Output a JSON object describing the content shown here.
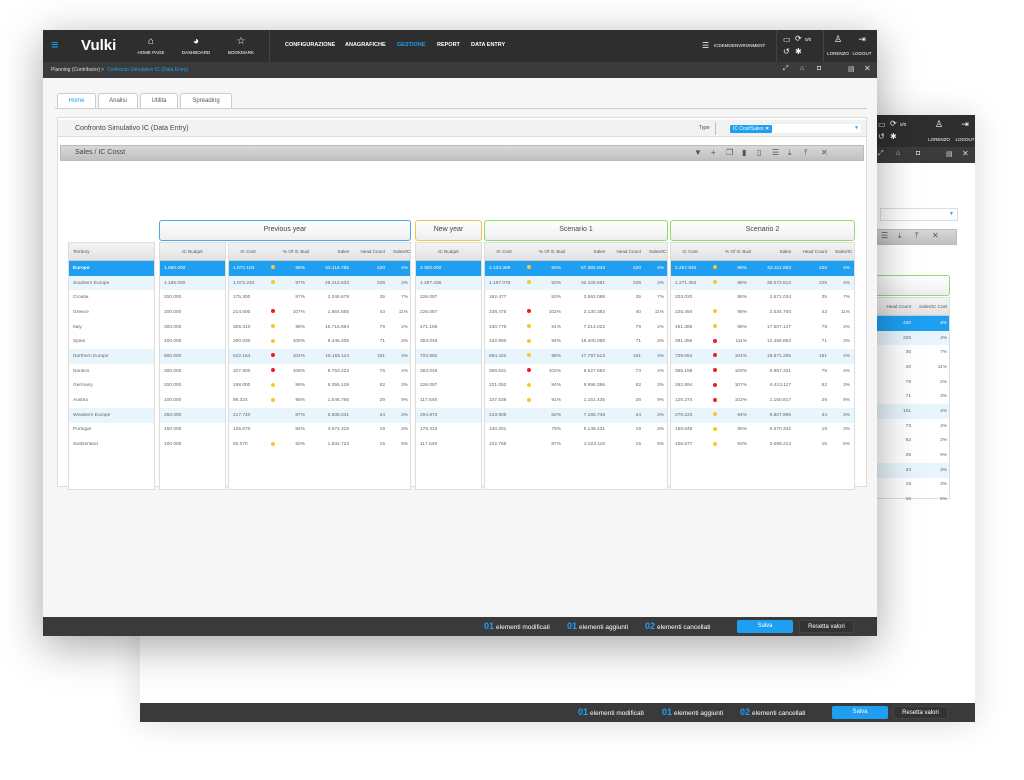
{
  "app": {
    "logo": "Vulki",
    "menu_icon": "hamburger-icon",
    "nav_icons": [
      {
        "label": "HOME PAGE",
        "icon": "home-icon"
      },
      {
        "label": "DASHBOARD",
        "icon": "dashboard-icon"
      },
      {
        "label": "BOOKMARK",
        "icon": "star-icon"
      }
    ],
    "menu": [
      "CONFIGURAZIONE",
      "ANAGRAFICHE",
      "GESTIONE",
      "REPORT",
      "DATA ENTRY"
    ],
    "active_menu": "GESTIONE",
    "environment": "ICDEMOENVIRONMENT",
    "sync_count": "0/0",
    "user": "LORENZO",
    "logout": "LOGOUT"
  },
  "breadcrumb": {
    "root": "Planning (Contributor)",
    "sep": ">",
    "current": "Confronto Simulativo IC (Data Entry)"
  },
  "tabs": [
    "Home",
    "Analisi",
    "Utilita",
    "Spreading"
  ],
  "panel": {
    "title": "Confronto Simulativo IC (Data Entry)",
    "type_label": "Type",
    "type_chip": "IC Cost/Sales",
    "grid_title": "Sales / IC Cosst"
  },
  "groups": {
    "prev": "Previous year",
    "new": "New year",
    "s1": "Scenario 1",
    "s2": "Scenario 2"
  },
  "columns": {
    "territory": "Territory",
    "budget": "IC Budget",
    "cost": "IC Cost",
    "pct": "% Of IC Budget",
    "sales": "Sales",
    "hc": "Head Count",
    "ratio": "Sales/IC Cost"
  },
  "colors": {
    "accent": "#1e9ff2",
    "yellow": "#f7c82b",
    "red": "#e8221b"
  },
  "rows": [
    {
      "t": "Europe",
      "k": "sel",
      "b": "1.950.000",
      "p": [
        "1.872.104",
        "y",
        "98%",
        "52.116.785",
        "420",
        "4%"
      ],
      "n": "2.300.000",
      "s1": [
        "2.134.369",
        "y",
        "93%",
        "57.382.843",
        "420",
        "4%"
      ],
      "s2": [
        "2.267.940",
        "y",
        "99%",
        "63.311.683",
        "420",
        "4%"
      ]
    },
    {
      "t": "Southern Europe",
      "k": "sub",
      "b": "1.185.000",
      "p": [
        "1.072.240",
        "y",
        "97%",
        "29.412.633",
        "225",
        "4%"
      ],
      "n": "1.397.436",
      "s1": [
        "1.197.076",
        "y",
        "93%",
        "32.426.681",
        "225",
        "4%"
      ],
      "s2": [
        "1.271.353",
        "y",
        "98%",
        "35.072.812",
        "225",
        "4%"
      ]
    },
    {
      "t": "Croatia",
      "k": "",
      "b": "200.000",
      "p": [
        "175.300",
        "",
        "87%",
        "2.346.679",
        "35",
        "7%"
      ],
      "n": "226.087",
      "s1": [
        "182.477",
        "",
        "83%",
        "2.562.088",
        "35",
        "7%"
      ],
      "s2": [
        "203.020",
        "",
        "88%",
        "2.671.034",
        "35",
        "7%"
      ]
    },
    {
      "t": "Greece",
      "k": "",
      "b": "200.000",
      "p": [
        "214.500",
        "r",
        "107%",
        "1.864.855",
        "43",
        "11%"
      ],
      "n": "226.087",
      "s1": [
        "238.475",
        "r",
        "102%",
        "2.130.383",
        "40",
        "11%"
      ],
      "s2": [
        "225.494",
        "y",
        "98%",
        "2.034.700",
        "43",
        "11%"
      ]
    },
    {
      "t": "Italy",
      "k": "",
      "b": "300.000",
      "p": [
        "305.310",
        "y",
        "98%",
        "15.715.894",
        "79",
        "2%"
      ],
      "n": "471.195",
      "s1": [
        "430.776",
        "y",
        "91%",
        "7.214.022",
        "79",
        "2%"
      ],
      "s2": [
        "451.385",
        "y",
        "98%",
        "17.607.147",
        "79",
        "2%"
      ]
    },
    {
      "t": "Spain",
      "k": "",
      "b": "400.000",
      "p": [
        "200.030",
        "y",
        "100%",
        "9.446.205",
        "71",
        "3%"
      ],
      "n": "353.046",
      "s1": [
        "332.950",
        "y",
        "94%",
        "19.400.088",
        "71",
        "3%"
      ],
      "s2": [
        "391.356",
        "r",
        "111%",
        "12.456.863",
        "71",
        "3%"
      ]
    },
    {
      "t": "Northern Europe",
      "k": "sub",
      "b": "600.000",
      "p": [
        "622.164",
        "r",
        "104%",
        "15.155.114",
        "181",
        "4%"
      ],
      "n": "703.992",
      "s1": [
        "694.422",
        "y",
        "98%",
        "17.797.513",
        "161",
        "4%"
      ],
      "s2": [
        "739.064",
        "r",
        "104%",
        "18.671.265",
        "161",
        "4%"
      ]
    },
    {
      "t": "Nordics",
      "k": "",
      "b": "300.000",
      "p": [
        "327.900",
        "r",
        "109%",
        "8.753.223",
        "75",
        "4%"
      ],
      "n": "353.046",
      "s1": [
        "366.631",
        "r",
        "102%",
        "9.627.692",
        "73",
        "4%"
      ],
      "s2": [
        "365.158",
        "r",
        "103%",
        "9.967.331",
        "75",
        "4%"
      ]
    },
    {
      "t": "Germany",
      "k": "",
      "b": "200.000",
      "p": [
        "198.000",
        "y",
        "99%",
        "6.356.129",
        "62",
        "3%"
      ],
      "n": "226.087",
      "s1": [
        "221.052",
        "y",
        "94%",
        "6.996.386",
        "62",
        "3%"
      ],
      "s2": [
        "262.894",
        "r",
        "107%",
        "6.413.117",
        "62",
        "3%"
      ]
    },
    {
      "t": "Austria",
      "k": "",
      "b": "100.000",
      "p": [
        "96.324",
        "y",
        "98%",
        "1.046.766",
        "29",
        "9%"
      ],
      "n": "117.549",
      "s1": [
        "107.539",
        "y",
        "91%",
        "1.151.435",
        "26",
        "9%"
      ],
      "s2": [
        "120.274",
        "r",
        "102%",
        "1.160.817",
        "29",
        "9%"
      ]
    },
    {
      "t": "Weastern Europe",
      "k": "sub",
      "b": "250.000",
      "p": [
        "217.740",
        "",
        "87%",
        "6.508.041",
        "34",
        "3%"
      ],
      "n": "294.872",
      "s1": [
        "243.908",
        "",
        "82%",
        "7.166.748",
        "34",
        "3%"
      ],
      "s2": [
        "279.223",
        "y",
        "94%",
        "6.807.995",
        "34",
        "3%"
      ]
    },
    {
      "t": "Portugal",
      "k": "",
      "b": "150.000",
      "p": [
        "125.670",
        "",
        "84%",
        "4.674.318",
        "19",
        "3%"
      ],
      "n": "176.423",
      "s1": [
        "140.201",
        "",
        "79%",
        "5.146.431",
        "19",
        "3%"
      ],
      "s2": [
        "168.646",
        "y",
        "95%",
        "6.570.342",
        "19",
        "3%"
      ]
    },
    {
      "t": "Switzerland",
      "k": "",
      "b": "100.000",
      "p": [
        "92.070",
        "y",
        "92%",
        "1.834.723",
        "15",
        "5%"
      ],
      "n": "117.549",
      "s1": [
        "102.769",
        "",
        "87%",
        "2.023.116",
        "15",
        "5%"
      ],
      "s2": [
        "106.577",
        "y",
        "93%",
        "3.089.213",
        "15",
        "5%"
      ]
    }
  ],
  "footer": {
    "modified_count": "01",
    "modified": "elementi modificati",
    "added_count": "01",
    "added": "elementi aggiunti",
    "deleted_count": "02",
    "deleted": "elementi cancellati",
    "save": "Salva",
    "reset": "Resetta valori"
  }
}
